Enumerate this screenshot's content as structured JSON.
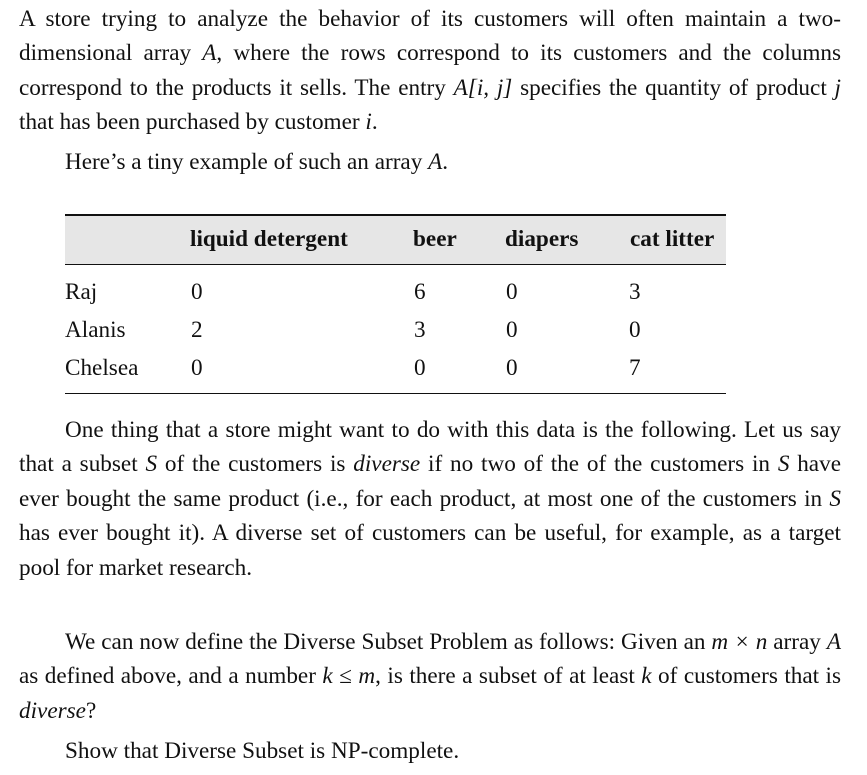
{
  "problem": {
    "intro_segments": [
      "A store trying to analyze the behavior of its customers will often maintain a two-dimensional array ",
      "A",
      ", where the rows correspond to its customers and the columns correspond to the products it sells. The entry ",
      "A[i, j]",
      " specifies the quantity of product ",
      "j",
      " that has been purchased by customer ",
      "i",
      "."
    ],
    "example_text": "Here’s a tiny example of such an array ",
    "example_var": "A",
    "example_end": ".",
    "diverse_segments": [
      "One thing that a store might want to do with this data is the following. Let us say that a subset ",
      "S",
      " of the customers is ",
      "diverse",
      " if no two of the of the customers in ",
      "S",
      " have ever bought the same product (i.e., for each product, at most one of the customers in ",
      "S",
      " has ever bought it). A diverse set of customers can be useful, for example, as a target pool for market research."
    ],
    "define_segments": [
      "We can now define the Diverse Subset Problem as follows: Given an ",
      "m × n",
      " array ",
      "A",
      " as defined above, and a number ",
      "k ≤ m",
      ", is there a subset of at least ",
      "k",
      " of customers that is ",
      "diverse",
      "?"
    ],
    "show_text": "Show that Diverse Subset is NP-complete."
  },
  "table": {
    "headers": [
      "",
      "liquid detergent",
      "beer",
      "diapers",
      "cat litter"
    ],
    "rows": [
      {
        "name": "Raj",
        "values": [
          "0",
          "6",
          "0",
          "3"
        ]
      },
      {
        "name": "Alanis",
        "values": [
          "2",
          "3",
          "0",
          "0"
        ]
      },
      {
        "name": "Chelsea",
        "values": [
          "0",
          "0",
          "0",
          "7"
        ]
      }
    ]
  }
}
